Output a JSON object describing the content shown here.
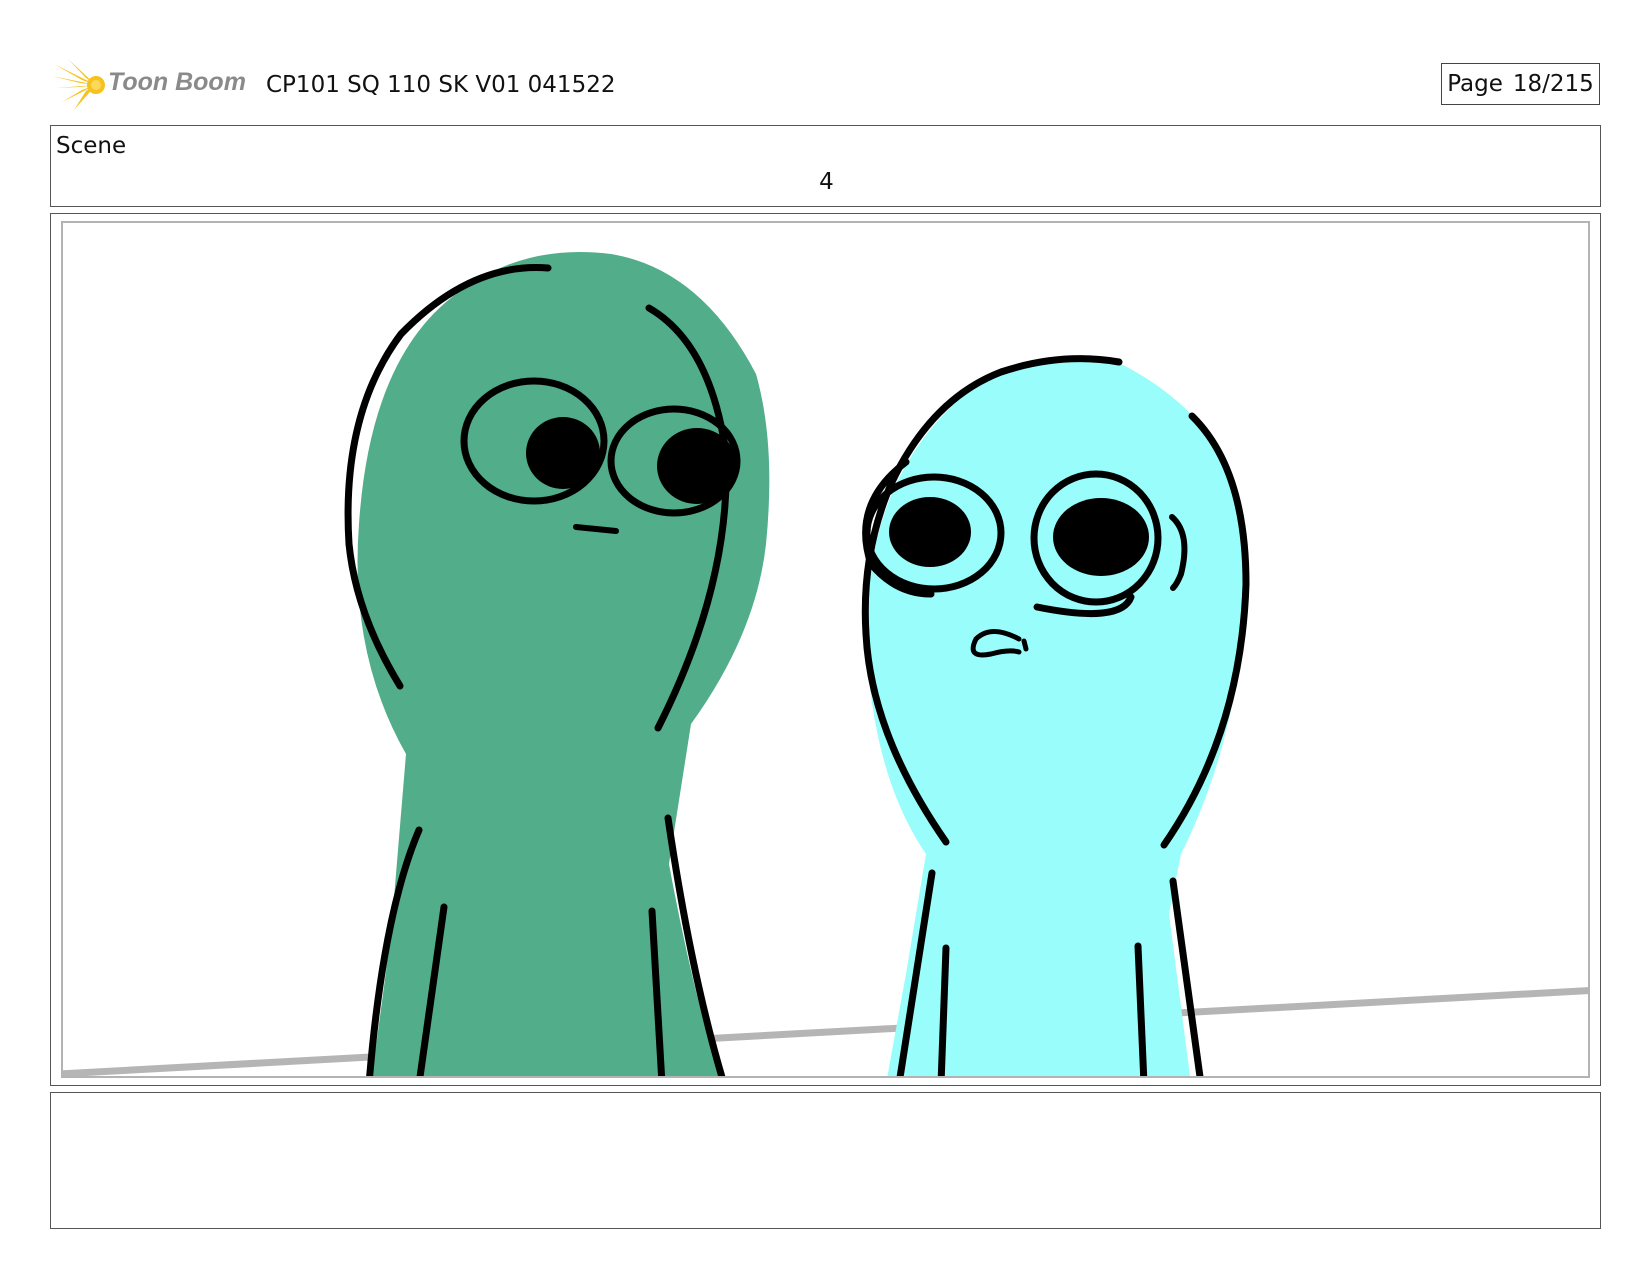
{
  "header": {
    "logo_text": "Toon Boom",
    "document_title": "CP101 SQ 110 SK V01 041522",
    "page_label": "Page",
    "page_number": "18/215"
  },
  "scene": {
    "label": "Scene",
    "number": "4"
  },
  "colors": {
    "green_character": "#52ad8a",
    "cyan_character": "#98fdfb",
    "outline": "#000000",
    "floor_line": "#b5b5b5",
    "logo_star": "#f7c21b"
  }
}
